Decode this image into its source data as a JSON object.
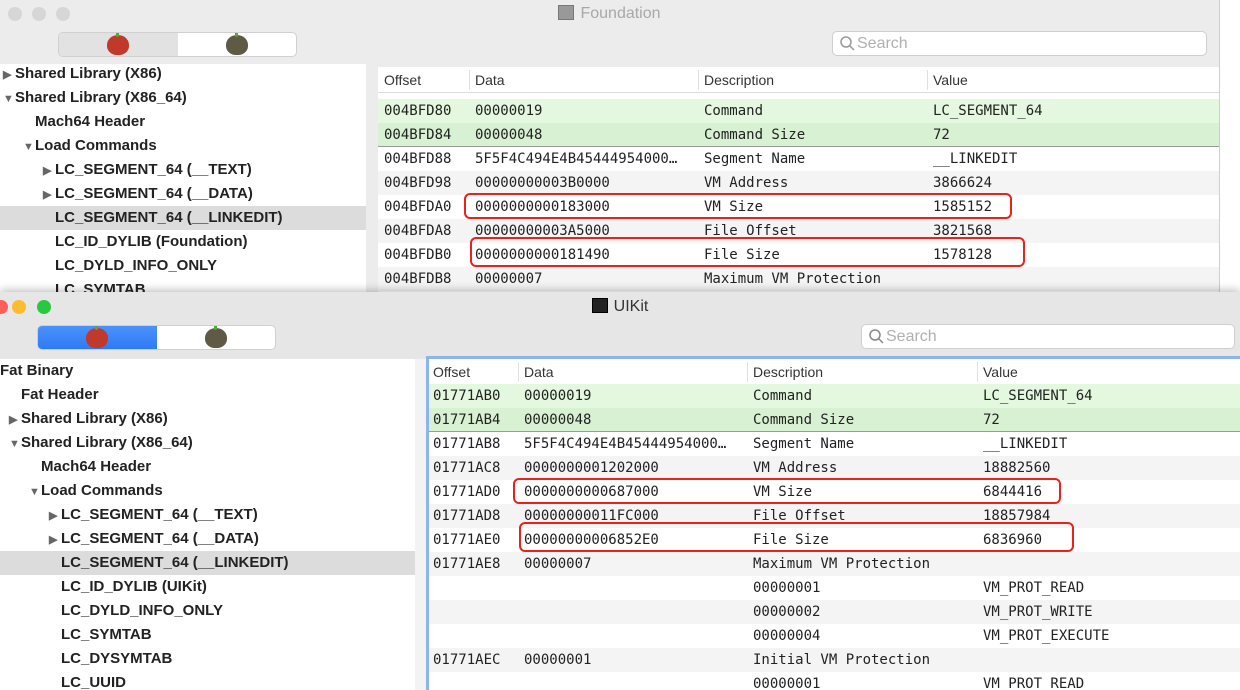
{
  "colors": {
    "highlight_green": "#e3f8de",
    "annotation_red": "#e8231c",
    "segment_selected_blue": "#2f7bf5"
  },
  "windows": [
    {
      "title": "Foundation",
      "search_placeholder": "Search",
      "active": false,
      "columns": [
        "Offset",
        "Data",
        "Description",
        "Value"
      ],
      "tree": [
        {
          "label": "Shared Library  (X86)",
          "level": 0,
          "toggle": "collapsed"
        },
        {
          "label": "Shared Library  (X86_64)",
          "level": 0,
          "toggle": "expanded"
        },
        {
          "label": "Mach64 Header",
          "level": 1,
          "toggle": "none"
        },
        {
          "label": "Load Commands",
          "level": 1,
          "toggle": "expanded"
        },
        {
          "label": "LC_SEGMENT_64 (__TEXT)",
          "level": 2,
          "toggle": "collapsed"
        },
        {
          "label": "LC_SEGMENT_64 (__DATA)",
          "level": 2,
          "toggle": "collapsed"
        },
        {
          "label": "LC_SEGMENT_64 (__LINKEDIT)",
          "level": 2,
          "toggle": "none",
          "selected": true
        },
        {
          "label": "LC_ID_DYLIB (Foundation)",
          "level": 2,
          "toggle": "none"
        },
        {
          "label": "LC_DYLD_INFO_ONLY",
          "level": 2,
          "toggle": "none"
        },
        {
          "label": "LC_SYMTAB",
          "level": 2,
          "toggle": "none"
        }
      ],
      "rows": [
        {
          "offset": "004BFD80",
          "data": "00000019",
          "description": "Command",
          "value": "LC_SEGMENT_64",
          "highlight": true
        },
        {
          "offset": "004BFD84",
          "data": "00000048",
          "description": "Command Size",
          "value": "72",
          "highlight": true
        },
        {
          "offset": "004BFD88",
          "data": "5F5F4C494E4B45444954000…",
          "description": "Segment Name",
          "value": "__LINKEDIT"
        },
        {
          "offset": "004BFD98",
          "data": "00000000003B0000",
          "description": "VM Address",
          "value": "3866624"
        },
        {
          "offset": "004BFDA0",
          "data": "0000000000183000",
          "description": "VM Size",
          "value": "1585152",
          "annotated": true
        },
        {
          "offset": "004BFDA8",
          "data": "00000000003A5000",
          "description": "File Offset",
          "value": "3821568"
        },
        {
          "offset": "004BFDB0",
          "data": "0000000000181490",
          "description": "File Size",
          "value": "1578128",
          "annotated": true
        },
        {
          "offset": "004BFDB8",
          "data": "00000007",
          "description": "Maximum VM Protection",
          "value": ""
        }
      ]
    },
    {
      "title": "UIKit",
      "search_placeholder": "Search",
      "active": true,
      "columns": [
        "Offset",
        "Data",
        "Description",
        "Value"
      ],
      "tree": [
        {
          "label": "Fat Binary",
          "level": -1,
          "toggle": "none"
        },
        {
          "label": "Fat Header",
          "level": 0,
          "toggle": "none"
        },
        {
          "label": "Shared Library  (X86)",
          "level": 0,
          "toggle": "collapsed"
        },
        {
          "label": "Shared Library  (X86_64)",
          "level": 0,
          "toggle": "expanded"
        },
        {
          "label": "Mach64 Header",
          "level": 1,
          "toggle": "none"
        },
        {
          "label": "Load Commands",
          "level": 1,
          "toggle": "expanded"
        },
        {
          "label": "LC_SEGMENT_64 (__TEXT)",
          "level": 2,
          "toggle": "collapsed"
        },
        {
          "label": "LC_SEGMENT_64 (__DATA)",
          "level": 2,
          "toggle": "collapsed"
        },
        {
          "label": "LC_SEGMENT_64 (__LINKEDIT)",
          "level": 2,
          "toggle": "none",
          "selected": true
        },
        {
          "label": "LC_ID_DYLIB (UIKit)",
          "level": 2,
          "toggle": "none"
        },
        {
          "label": "LC_DYLD_INFO_ONLY",
          "level": 2,
          "toggle": "none"
        },
        {
          "label": "LC_SYMTAB",
          "level": 2,
          "toggle": "none"
        },
        {
          "label": "LC_DYSYMTAB",
          "level": 2,
          "toggle": "none"
        },
        {
          "label": "LC_UUID",
          "level": 2,
          "toggle": "none"
        }
      ],
      "rows": [
        {
          "offset": "01771AB0",
          "data": "00000019",
          "description": "Command",
          "value": "LC_SEGMENT_64",
          "highlight": true
        },
        {
          "offset": "01771AB4",
          "data": "00000048",
          "description": "Command Size",
          "value": "72",
          "highlight": true
        },
        {
          "offset": "01771AB8",
          "data": "5F5F4C494E4B45444954000…",
          "description": "Segment Name",
          "value": "__LINKEDIT"
        },
        {
          "offset": "01771AC8",
          "data": "0000000001202000",
          "description": "VM Address",
          "value": "18882560"
        },
        {
          "offset": "01771AD0",
          "data": "0000000000687000",
          "description": "VM Size",
          "value": "6844416",
          "annotated": true
        },
        {
          "offset": "01771AD8",
          "data": "00000000011FC000",
          "description": "File Offset",
          "value": "18857984"
        },
        {
          "offset": "01771AE0",
          "data": "00000000006852E0",
          "description": "File Size",
          "value": "6836960",
          "annotated": true
        },
        {
          "offset": "01771AE8",
          "data": "00000007",
          "description": "Maximum VM Protection",
          "value": ""
        },
        {
          "offset": "",
          "data": "",
          "description": "00000001",
          "value": "VM_PROT_READ"
        },
        {
          "offset": "",
          "data": "",
          "description": "00000002",
          "value": "VM_PROT_WRITE"
        },
        {
          "offset": "",
          "data": "",
          "description": "00000004",
          "value": "VM_PROT_EXECUTE"
        },
        {
          "offset": "01771AEC",
          "data": "00000001",
          "description": "Initial VM Protection",
          "value": ""
        },
        {
          "offset": "",
          "data": "",
          "description": "00000001",
          "value": "VM_PROT_READ"
        }
      ]
    }
  ]
}
